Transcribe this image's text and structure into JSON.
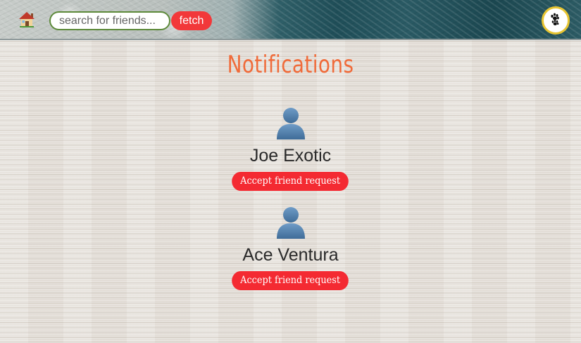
{
  "header": {
    "search": {
      "placeholder": "search for friends...",
      "value": ""
    },
    "fetch_label": "fetch",
    "home_icon": "house-icon",
    "profile_icon": "paw-prints-icon"
  },
  "main": {
    "title": "Notifications",
    "requests": [
      {
        "name": "Joe Exotic",
        "action_label": "Accept friend request",
        "avatar_icon": "user-silhouette-icon"
      },
      {
        "name": "Ace Ventura",
        "action_label": "Accept friend request",
        "avatar_icon": "user-silhouette-icon"
      }
    ]
  },
  "colors": {
    "title": "#f06b3a",
    "button": "#f42a32",
    "search_border": "#5d8a3a",
    "profile_border": "#e8c531"
  }
}
